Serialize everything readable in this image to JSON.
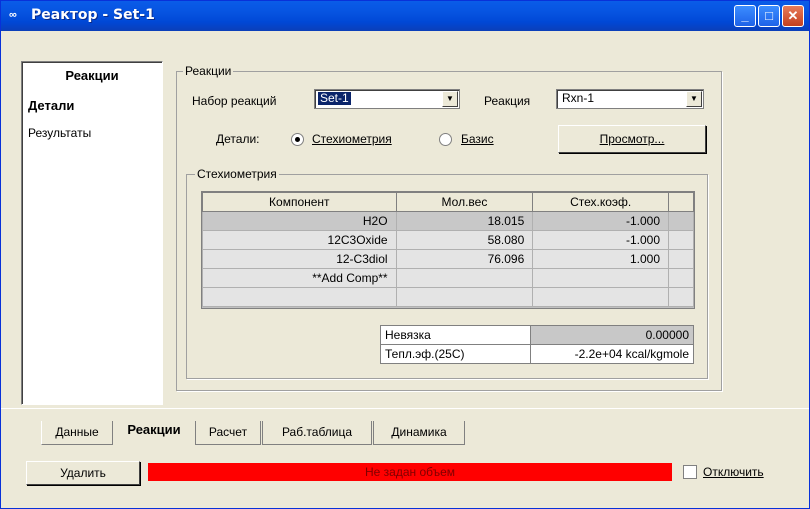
{
  "window": {
    "title": "Реактор - Set-1",
    "icon": "app-icon"
  },
  "sidebar": {
    "heading": "Реакции",
    "items": [
      {
        "label": "Детали",
        "active": true
      },
      {
        "label": "Результаты",
        "active": false
      }
    ]
  },
  "reactions_group": {
    "label": "Реакции",
    "set_label": "Набор реакций",
    "set_value": "Set-1",
    "rxn_label": "Реакция",
    "rxn_value": "Rxn-1",
    "details_label": "Детали:",
    "radio_stoich": "Стехиометрия",
    "radio_basis": "Базис",
    "selected": "Стехиометрия",
    "view_button": "Просмотр..."
  },
  "stoich_group": {
    "label": "Стехиометрия",
    "columns": [
      "Компонент",
      "Мол.вес",
      "Стех.коэф."
    ],
    "rows": [
      [
        "H2O",
        "18.015",
        "-1.000"
      ],
      [
        "12C3Oxide",
        "58.080",
        "-1.000"
      ],
      [
        "12-C3diol",
        "76.096",
        "1.000"
      ],
      [
        "**Add Comp**",
        "",
        ""
      ],
      [
        "",
        "",
        ""
      ]
    ],
    "summary": [
      {
        "label": "Невязка",
        "value": "0.00000"
      },
      {
        "label": "Тепл.эф.(25C)",
        "value": "-2.2e+04 kcal/kgmole"
      }
    ]
  },
  "tabs": [
    {
      "label": "Данные",
      "active": false
    },
    {
      "label": "Реакции",
      "active": true
    },
    {
      "label": "Расчет",
      "active": false
    },
    {
      "label": "Раб.таблица",
      "active": false
    },
    {
      "label": "Динамика",
      "active": false
    }
  ],
  "footer": {
    "delete_button": "Удалить",
    "status_text": "Не задан объем",
    "status_color": "#ff0000",
    "disable_label": "Отключить",
    "disable_checked": false
  }
}
